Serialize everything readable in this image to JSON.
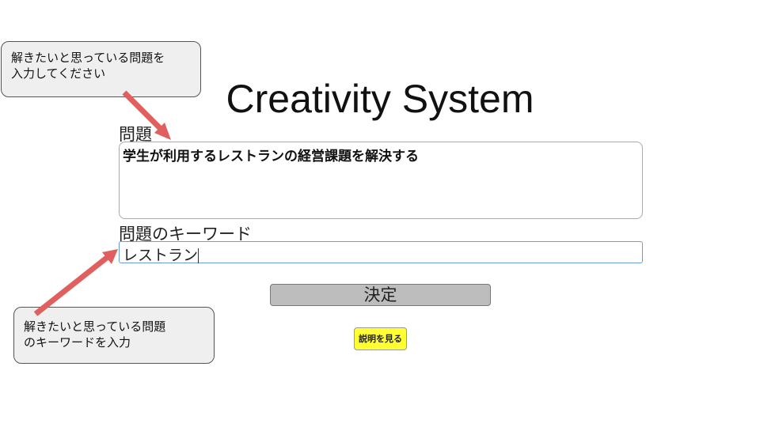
{
  "header": {
    "title": "Creativity System"
  },
  "problem": {
    "label": "問題",
    "value": "学生が利用するレストランの経営課題を解決する"
  },
  "keyword": {
    "label": "問題のキーワード",
    "value": "レストラン"
  },
  "actions": {
    "submit_label": "決定",
    "help_label": "説明を見る"
  },
  "callouts": [
    {
      "text_line1": "解きたいと思っている問題を",
      "text_line2": "入力してください"
    },
    {
      "text_line1": "解きたいと思っている問題",
      "text_line2": "のキーワードを入力"
    }
  ],
  "colors": {
    "arrow": "#e06060",
    "help_button": "#ffff33",
    "submit_button": "#bdbdbd"
  }
}
